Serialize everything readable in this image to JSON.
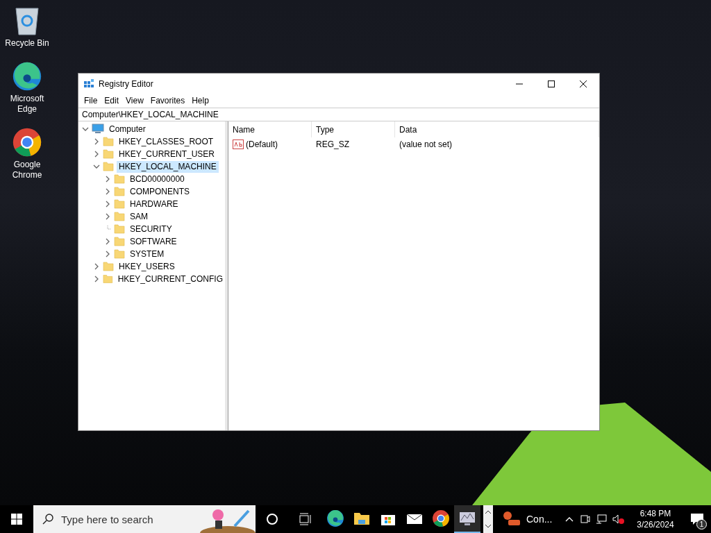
{
  "desktop_icons": [
    {
      "kind": "bin",
      "label": "Recycle Bin"
    },
    {
      "kind": "edge",
      "label": "Microsoft Edge"
    },
    {
      "kind": "chrome",
      "label": "Google Chrome"
    }
  ],
  "window": {
    "title": "Registry Editor"
  },
  "menu": [
    "File",
    "Edit",
    "View",
    "Favorites",
    "Help"
  ],
  "address": "Computer\\HKEY_LOCAL_MACHINE",
  "tree": {
    "label": "Computer",
    "expandable": true,
    "expanded": true,
    "selected": false,
    "children": [
      {
        "label": "HKEY_CLASSES_ROOT",
        "expandable": true,
        "expanded": false,
        "selected": false
      },
      {
        "label": "HKEY_CURRENT_USER",
        "expandable": true,
        "expanded": false,
        "selected": false
      },
      {
        "label": "HKEY_LOCAL_MACHINE",
        "expandable": true,
        "expanded": true,
        "selected": true,
        "children": [
          {
            "label": "BCD00000000",
            "expandable": true,
            "expanded": false,
            "selected": false
          },
          {
            "label": "COMPONENTS",
            "expandable": true,
            "expanded": false,
            "selected": false
          },
          {
            "label": "HARDWARE",
            "expandable": true,
            "expanded": false,
            "selected": false
          },
          {
            "label": "SAM",
            "expandable": true,
            "expanded": false,
            "selected": false
          },
          {
            "label": "SECURITY",
            "expandable": false,
            "expanded": false,
            "selected": false
          },
          {
            "label": "SOFTWARE",
            "expandable": true,
            "expanded": false,
            "selected": false
          },
          {
            "label": "SYSTEM",
            "expandable": true,
            "expanded": false,
            "selected": false
          }
        ]
      },
      {
        "label": "HKEY_USERS",
        "expandable": true,
        "expanded": false,
        "selected": false
      },
      {
        "label": "HKEY_CURRENT_CONFIG",
        "expandable": true,
        "expanded": false,
        "selected": false
      }
    ]
  },
  "table": {
    "columns": [
      "Name",
      "Type",
      "Data"
    ],
    "rows": [
      {
        "name": "(Default)",
        "type": "REG_SZ",
        "data": "(value not set)"
      }
    ]
  },
  "taskbar": {
    "search_placeholder": "Type here to search",
    "apps": [
      {
        "kind": "edge",
        "active": false
      },
      {
        "kind": "folder",
        "active": false
      },
      {
        "kind": "store",
        "active": false
      },
      {
        "kind": "mail",
        "active": false
      },
      {
        "kind": "chrome",
        "active": false
      },
      {
        "kind": "monitor",
        "active": true
      }
    ],
    "notification_app": "Con...",
    "time": "6:48 PM",
    "date": "3/26/2024",
    "notification_count": "1"
  }
}
